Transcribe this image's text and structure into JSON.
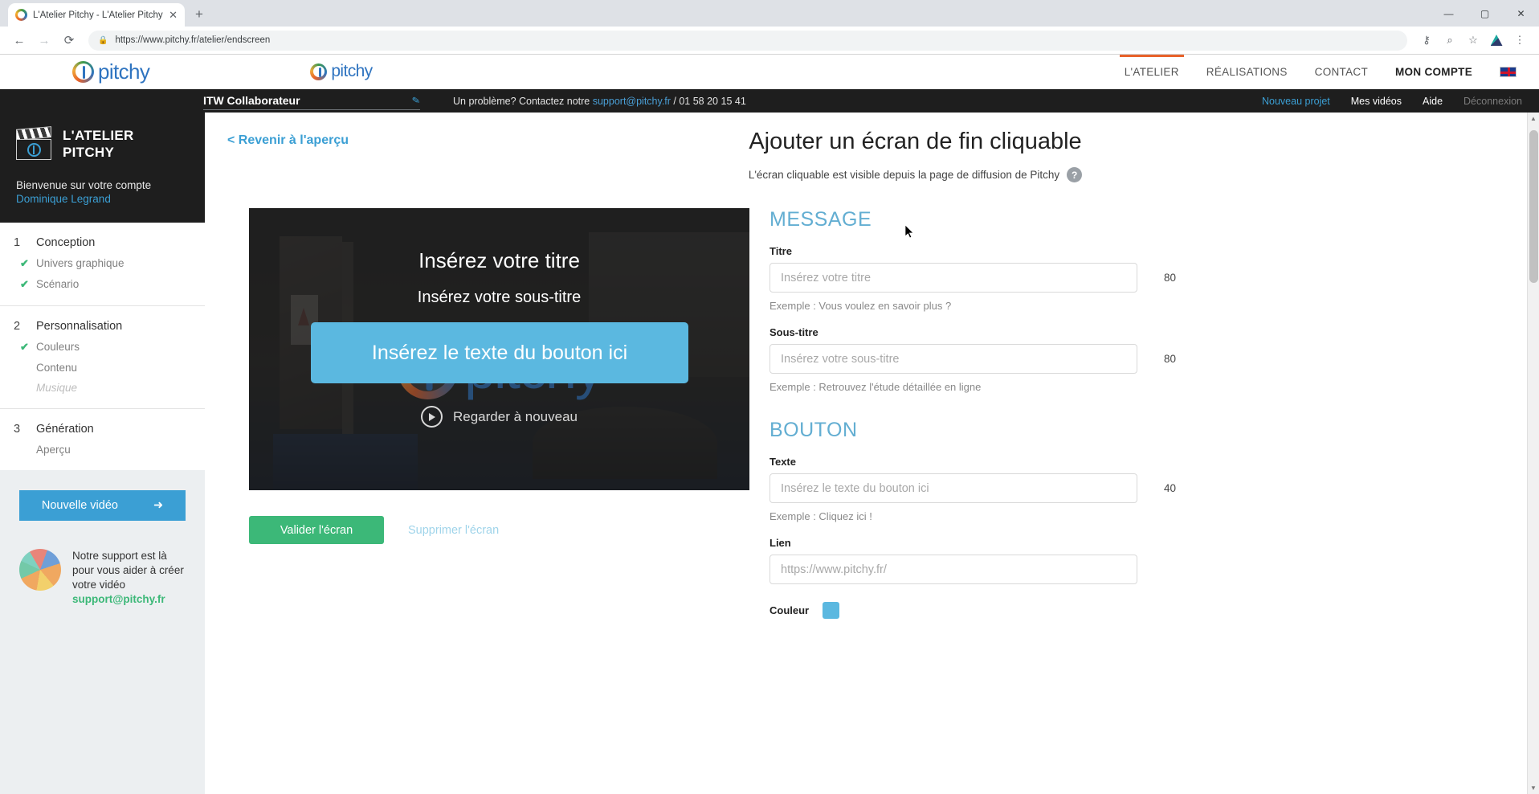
{
  "browser": {
    "tab_title": "L'Atelier Pitchy - L'Atelier Pitchy",
    "tab_close": "✕",
    "new_tab": "+",
    "back": "←",
    "forward": "→",
    "reload": "⟳",
    "lock_icon": "🔒",
    "url": "https://www.pitchy.fr/atelier/endscreen",
    "icons": {
      "key": "⚷",
      "zoom": "⌕",
      "bookmark": "☆",
      "menu": "⋮"
    },
    "window": {
      "minimize": "—",
      "maximize": "▢",
      "close": "✕"
    }
  },
  "site_header": {
    "logo_text": "pitchy",
    "logo_text_2": "pitchy",
    "nav": [
      {
        "label": "L'ATELIER",
        "active": true
      },
      {
        "label": "RÉALISATIONS",
        "active": false
      },
      {
        "label": "CONTACT",
        "active": false
      },
      {
        "label": "MON COMPTE",
        "active": false,
        "bold": true
      }
    ],
    "flag_label": "EN"
  },
  "dark_bar": {
    "project_name": "ITW Collaborateur",
    "edit_icon": "✎",
    "support_prefix": "Un problème? Contactez notre ",
    "support_email": "support@pitchy.fr",
    "support_phone": " / 01 58 20 15 41",
    "links": [
      {
        "label": "Nouveau projet",
        "style": "blue"
      },
      {
        "label": "Mes vidéos",
        "style": "white"
      },
      {
        "label": "Aide",
        "style": "white"
      },
      {
        "label": "Déconnexion",
        "style": "gray"
      }
    ]
  },
  "sidebar": {
    "brand_line1": "L'ATELIER",
    "brand_line2": "PITCHY",
    "welcome": "Bienvenue sur votre compte",
    "user_name": "Dominique Legrand",
    "steps": [
      {
        "num": "1",
        "title": "Conception",
        "items": [
          {
            "label": "Univers graphique",
            "done": true
          },
          {
            "label": "Scénario",
            "done": true
          }
        ]
      },
      {
        "num": "2",
        "title": "Personnalisation",
        "items": [
          {
            "label": "Couleurs",
            "done": true
          },
          {
            "label": "Contenu",
            "done": false
          },
          {
            "label": "Musique",
            "done": false,
            "muted": true
          }
        ]
      },
      {
        "num": "3",
        "title": "Génération",
        "items": [
          {
            "label": "Aperçu",
            "done": false
          }
        ]
      }
    ],
    "new_video_button": "Nouvelle vidéo",
    "new_video_arrow": "➜",
    "support_text": "Notre support est là pour vous aider à créer votre vidéo",
    "support_email": "support@pitchy.fr"
  },
  "main": {
    "back_link": "< Revenir à l'aperçu",
    "title": "Ajouter un écran de fin cliquable",
    "subtitle": "L'écran cliquable est visible depuis la page de diffusion de Pitchy",
    "help_icon": "?",
    "preview": {
      "title_placeholder": "Insérez votre titre",
      "subtitle_placeholder": "Insérez votre sous-titre",
      "button_placeholder": "Insérez le texte du bouton ici",
      "replay_label": "Regarder à nouveau",
      "watermark_text": "pitchy"
    },
    "validate_button": "Valider l'écran",
    "delete_button": "Supprimer l'écran"
  },
  "form": {
    "message_section": "MESSAGE",
    "bouton_section": "BOUTON",
    "titre": {
      "label": "Titre",
      "value": "",
      "placeholder": "Insérez votre titre",
      "count": "80",
      "hint": "Exemple : Vous voulez en savoir plus ?"
    },
    "sous_titre": {
      "label": "Sous-titre",
      "value": "",
      "placeholder": "Insérez votre sous-titre",
      "count": "80",
      "hint": "Exemple : Retrouvez l'étude détaillée en ligne"
    },
    "texte": {
      "label": "Texte",
      "value": "",
      "placeholder": "Insérez le texte du bouton ici",
      "count": "40",
      "hint": "Exemple : Cliquez ici !"
    },
    "lien": {
      "label": "Lien",
      "value": "",
      "placeholder": "https://www.pitchy.fr/"
    },
    "couleur": {
      "label": "Couleur",
      "value": "#5bb8e0"
    }
  },
  "colors": {
    "brand_blue": "#3b9fd4",
    "accent_orange": "#e8622a",
    "green": "#3cb878",
    "button_blue": "#5bb8e0",
    "section_heading": "#63aed2"
  }
}
